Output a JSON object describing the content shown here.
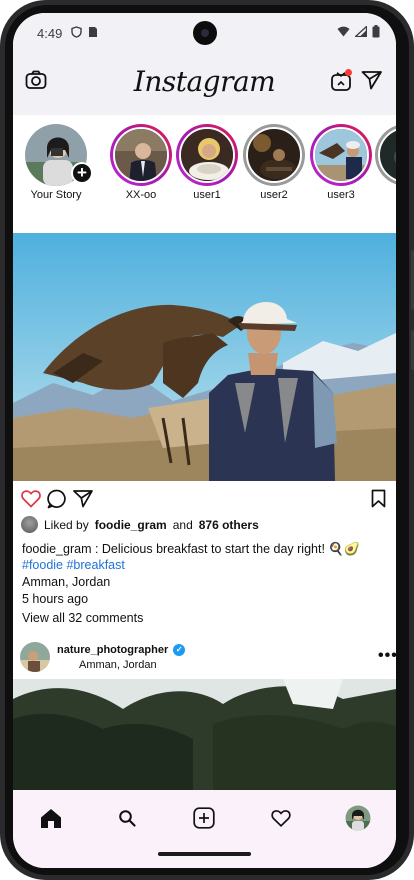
{
  "status_bar": {
    "time": "4:49"
  },
  "header": {
    "logo_text": "Instagram"
  },
  "stories": [
    {
      "label": "Your Story",
      "type": "own"
    },
    {
      "label": "XX-oo",
      "type": "active"
    },
    {
      "label": "user1",
      "type": "active"
    },
    {
      "label": "user2",
      "type": "seen"
    },
    {
      "label": "user3",
      "type": "active"
    },
    {
      "label": "",
      "type": "seen"
    }
  ],
  "post": {
    "liked_by_prefix": "Liked by",
    "liked_by_user": "foodie_gram",
    "liked_by_and": "and",
    "liked_by_others": "876 others",
    "caption": "foodie_gram : Delicious breakfast to start the day right! 🍳🥑",
    "hashtags": "#foodie #breakfast",
    "location": "Amman, Jordan",
    "time_ago": "5 hours ago",
    "view_comments": "View all 32 comments"
  },
  "post2": {
    "username": "nature_photographer",
    "location": "Amman, Jordan",
    "more": "•••"
  },
  "colors": {
    "accent_link": "#1d74d8",
    "story_ring": "#c026d3",
    "header_bg": "#f2f1f6",
    "nav_bg": "#fbf1fb"
  },
  "icons": [
    "camera-icon",
    "igtv-icon",
    "send-icon",
    "heart-icon",
    "comment-icon",
    "share-icon",
    "bookmark-icon",
    "home-icon",
    "search-icon",
    "add-post-icon",
    "activity-icon",
    "profile-avatar"
  ]
}
